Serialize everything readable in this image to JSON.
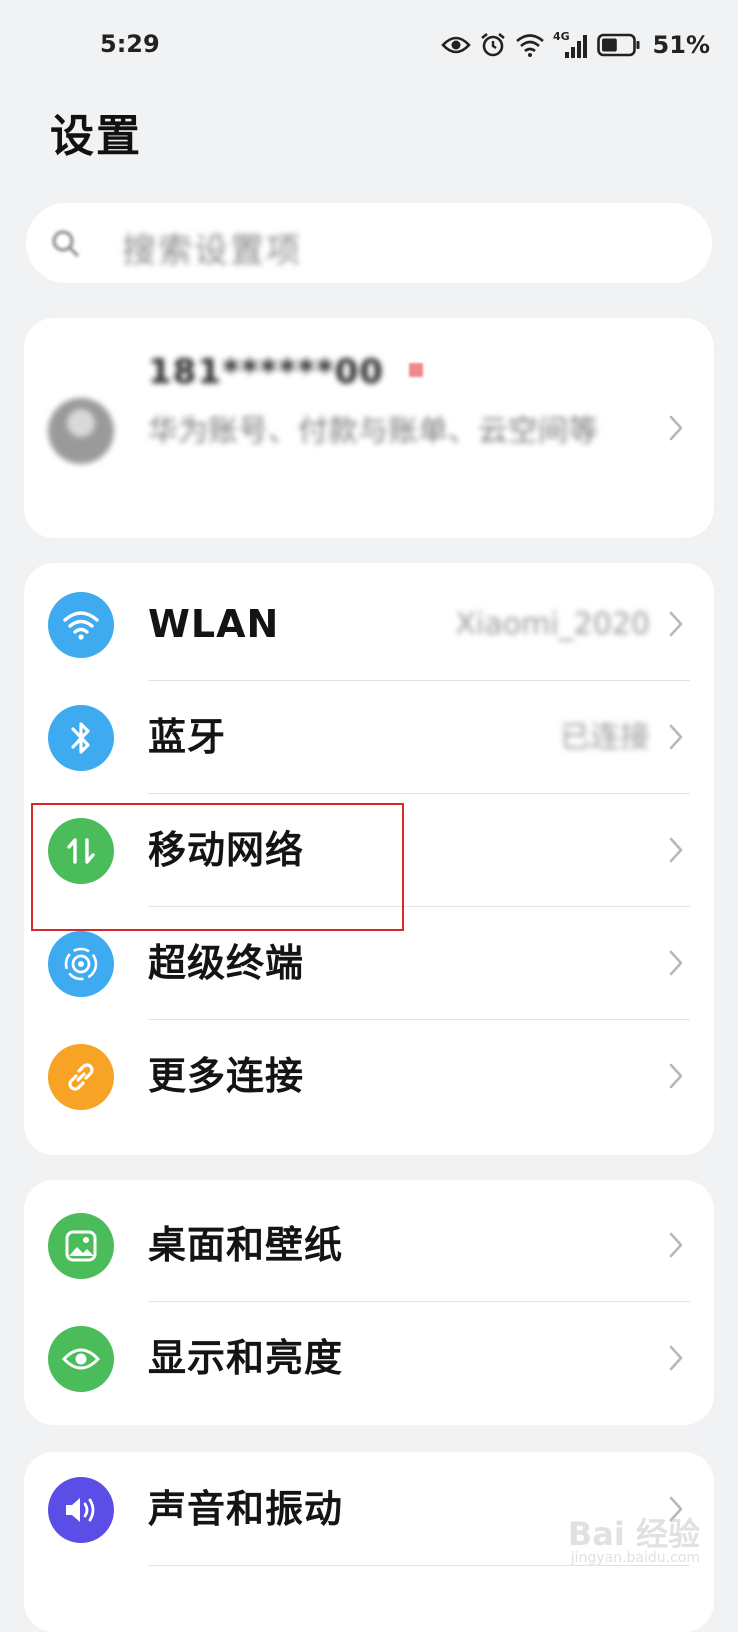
{
  "status_bar": {
    "time": "5:29",
    "network": "4G",
    "battery_percent": "51%",
    "battery_level": 0.51,
    "icons": [
      "eye-icon",
      "alarm-icon",
      "wifi-icon",
      "signal-icon",
      "battery-icon"
    ]
  },
  "page": {
    "title": "设置"
  },
  "search": {
    "placeholder": "搜索设置项"
  },
  "account": {
    "name": "181******00",
    "description": "华为账号、付款与账单、云空间等"
  },
  "connectivity": {
    "items": [
      {
        "label": "WLAN",
        "value": "Xiaomi_2020",
        "icon": "wifi-icon",
        "color": "#3eaaf0"
      },
      {
        "label": "蓝牙",
        "value": "已连接",
        "icon": "bluetooth-icon",
        "color": "#3eaaf0"
      },
      {
        "label": "移动网络",
        "value": "",
        "icon": "mobile-data-icon",
        "color": "#4bbc5a"
      },
      {
        "label": "超级终端",
        "value": "",
        "icon": "super-device-icon",
        "color": "#3eaaf0"
      },
      {
        "label": "更多连接",
        "value": "",
        "icon": "link-icon",
        "color": "#f7a326"
      }
    ]
  },
  "display": {
    "items": [
      {
        "label": "桌面和壁纸",
        "icon": "wallpaper-icon",
        "color": "#4bbc5a"
      },
      {
        "label": "显示和亮度",
        "icon": "eye-icon",
        "color": "#4bbc5a"
      }
    ]
  },
  "sound": {
    "items": [
      {
        "label": "声音和振动",
        "icon": "speaker-icon",
        "color": "#5b4ee6"
      }
    ]
  },
  "watermark": {
    "text": "Bai 经验",
    "sub": "jingyan.baidu.com"
  }
}
